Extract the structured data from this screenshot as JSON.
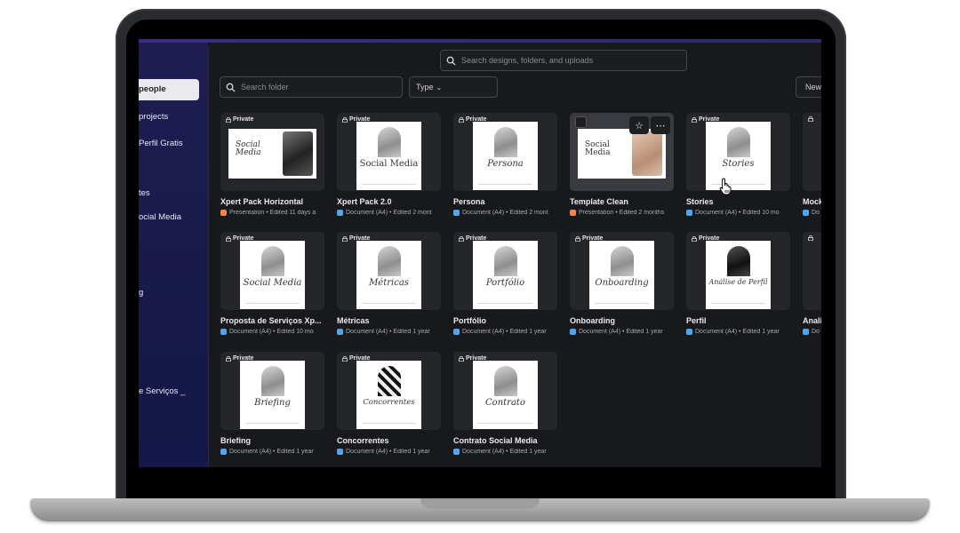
{
  "sidebar": {
    "items": [
      {
        "label": "people",
        "active": true
      },
      {
        "label": "projects"
      },
      {
        "label": "Perfil Gratis"
      },
      {
        "label": "tes"
      },
      {
        "label": "ocial Media"
      },
      {
        "label": "g"
      },
      {
        "label": "e Serviços _"
      }
    ]
  },
  "search": {
    "placeholder": "Search designs, folders, and uploads"
  },
  "folder_search": {
    "placeholder": "Search folder"
  },
  "filters": {
    "type_label": "Type",
    "sort_label": "Newe"
  },
  "private_label": "Private",
  "cards": [
    {
      "title": "Xpert Pack Horizontal",
      "meta": "Presentation • Edited 11 days a",
      "kind": "presentation",
      "thumb_text": "Social Media"
    },
    {
      "title": "Xpert Pack 2.0",
      "meta": "Document (A4) • Edited 2 mont",
      "kind": "document",
      "thumb_text": "Social Media"
    },
    {
      "title": "Persona",
      "meta": "Document (A4) • Edited 2 mont",
      "kind": "document",
      "thumb_text": "Persona"
    },
    {
      "title": "Template Clean",
      "meta": "Presentation • Edited 2 months",
      "kind": "presentation",
      "thumb_text": "Social Media"
    },
    {
      "title": "Stories",
      "meta": "Document (A4) • Edited 10 mo",
      "kind": "document",
      "thumb_text": "Stories"
    },
    {
      "title": "Mock",
      "meta": "Do",
      "kind": "document",
      "thumb_text": ""
    },
    {
      "title": "Proposta de Serviços Xp...",
      "meta": "Document (A4) • Edited 10 mo",
      "kind": "document",
      "thumb_text": "Social Media"
    },
    {
      "title": "Métricas",
      "meta": "Document (A4) • Edited 1 year",
      "kind": "document",
      "thumb_text": "Métricas"
    },
    {
      "title": "Portfólio",
      "meta": "Document (A4) • Edited 1 year",
      "kind": "document",
      "thumb_text": "Portfólio"
    },
    {
      "title": "Onboarding",
      "meta": "Document (A4) • Edited 1 year",
      "kind": "document",
      "thumb_text": "Onboarding"
    },
    {
      "title": "Perfil",
      "meta": "Document (A4) • Edited 1 year",
      "kind": "document",
      "thumb_text": "Análise de Perfil"
    },
    {
      "title": "Analis",
      "meta": "Do",
      "kind": "document",
      "thumb_text": ""
    },
    {
      "title": "Briefing",
      "meta": "Document (A4) • Edited 1 year",
      "kind": "document",
      "thumb_text": "Briefing"
    },
    {
      "title": "Concorrentes",
      "meta": "Document (A4) • Edited 1 year",
      "kind": "document",
      "thumb_text": "Concorrentes"
    },
    {
      "title": "Contrato Social Media",
      "meta": "Document (A4) • Edited 1 year",
      "kind": "document",
      "thumb_text": "Contrato"
    }
  ],
  "colors": {
    "background": "#18191c",
    "sidebar": "#1f1d54",
    "document_badge": "#4ea6f0",
    "presentation_badge": "#f2844b"
  },
  "icons": {
    "search": "search-icon",
    "lock": "lock-icon",
    "star": "star-icon",
    "more": "more-icon",
    "cursor": "hand-pointer-icon"
  }
}
